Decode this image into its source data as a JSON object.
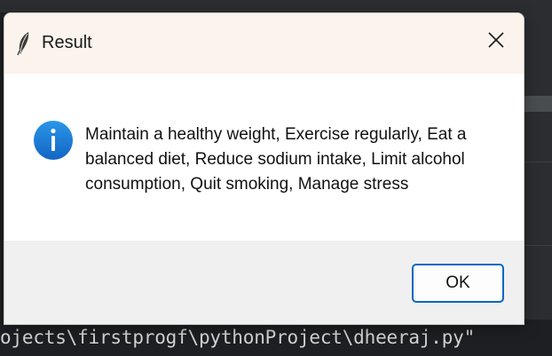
{
  "dialog": {
    "title": "Result",
    "message": "Maintain a healthy weight, Exercise regularly, Eat a balanced diet, Reduce sodium intake, Limit alcohol consumption, Quit smoking, Manage stress",
    "ok_label": "OK",
    "app_icon": "feather-icon",
    "message_icon": "info-icon",
    "close_icon": "close-icon"
  },
  "terminal": {
    "text": "ojects\\firstprogf\\pythonProject\\dheeraj.py\""
  },
  "colors": {
    "titlebar": "#fbf3ec",
    "info_icon": "#1a82d8",
    "ok_border": "#0067c0",
    "background": "#1e1f22"
  }
}
